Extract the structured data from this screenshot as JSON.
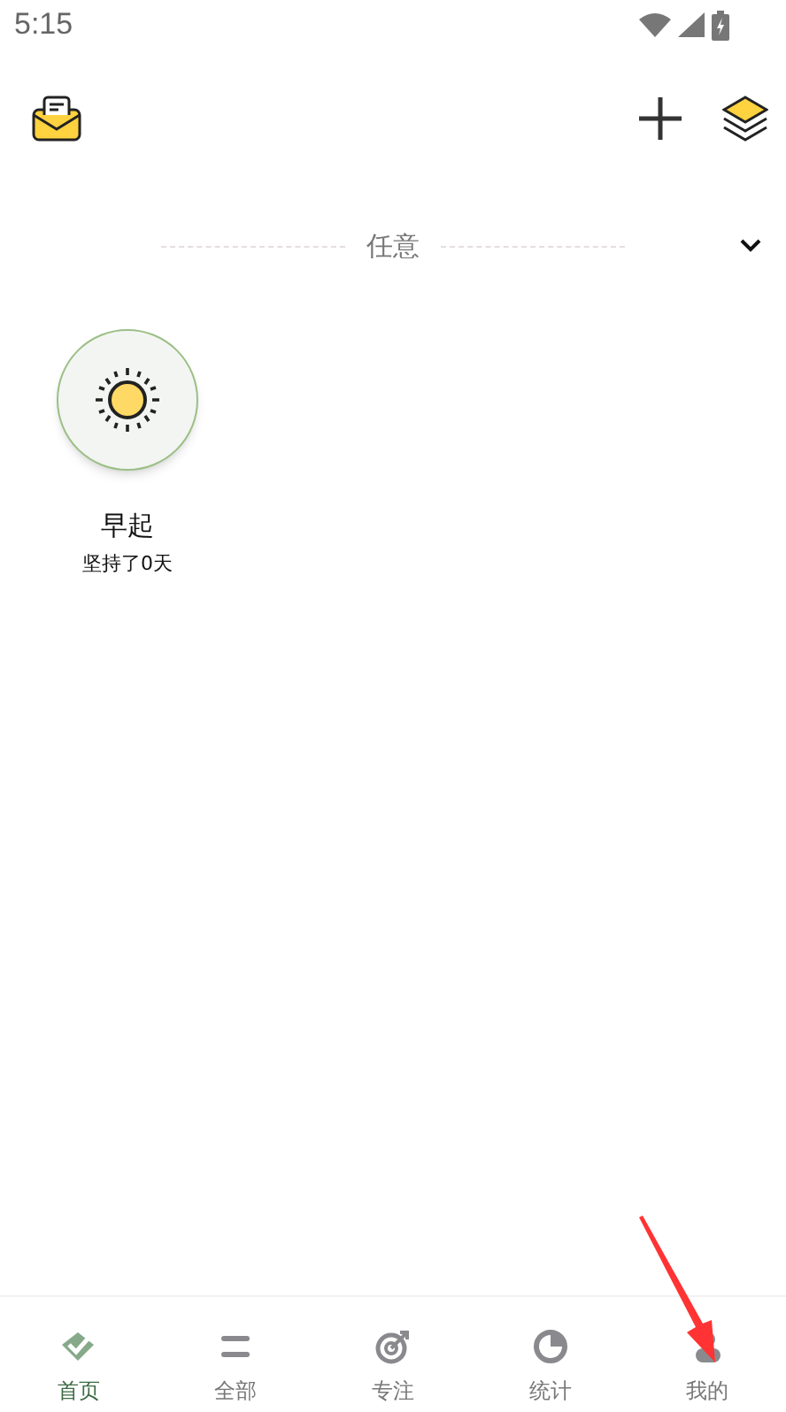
{
  "status_bar": {
    "time": "5:15"
  },
  "filter": {
    "label": "任意"
  },
  "habits": [
    {
      "name": "早起",
      "streak": "坚持了0天"
    }
  ],
  "tabs": [
    {
      "kind": "home",
      "label": "首页",
      "selected": true
    },
    {
      "kind": "list",
      "label": "全部",
      "selected": false
    },
    {
      "kind": "focus",
      "label": "专注",
      "selected": false
    },
    {
      "kind": "stats",
      "label": "统计",
      "selected": false
    },
    {
      "kind": "me",
      "label": "我的",
      "selected": false
    }
  ]
}
